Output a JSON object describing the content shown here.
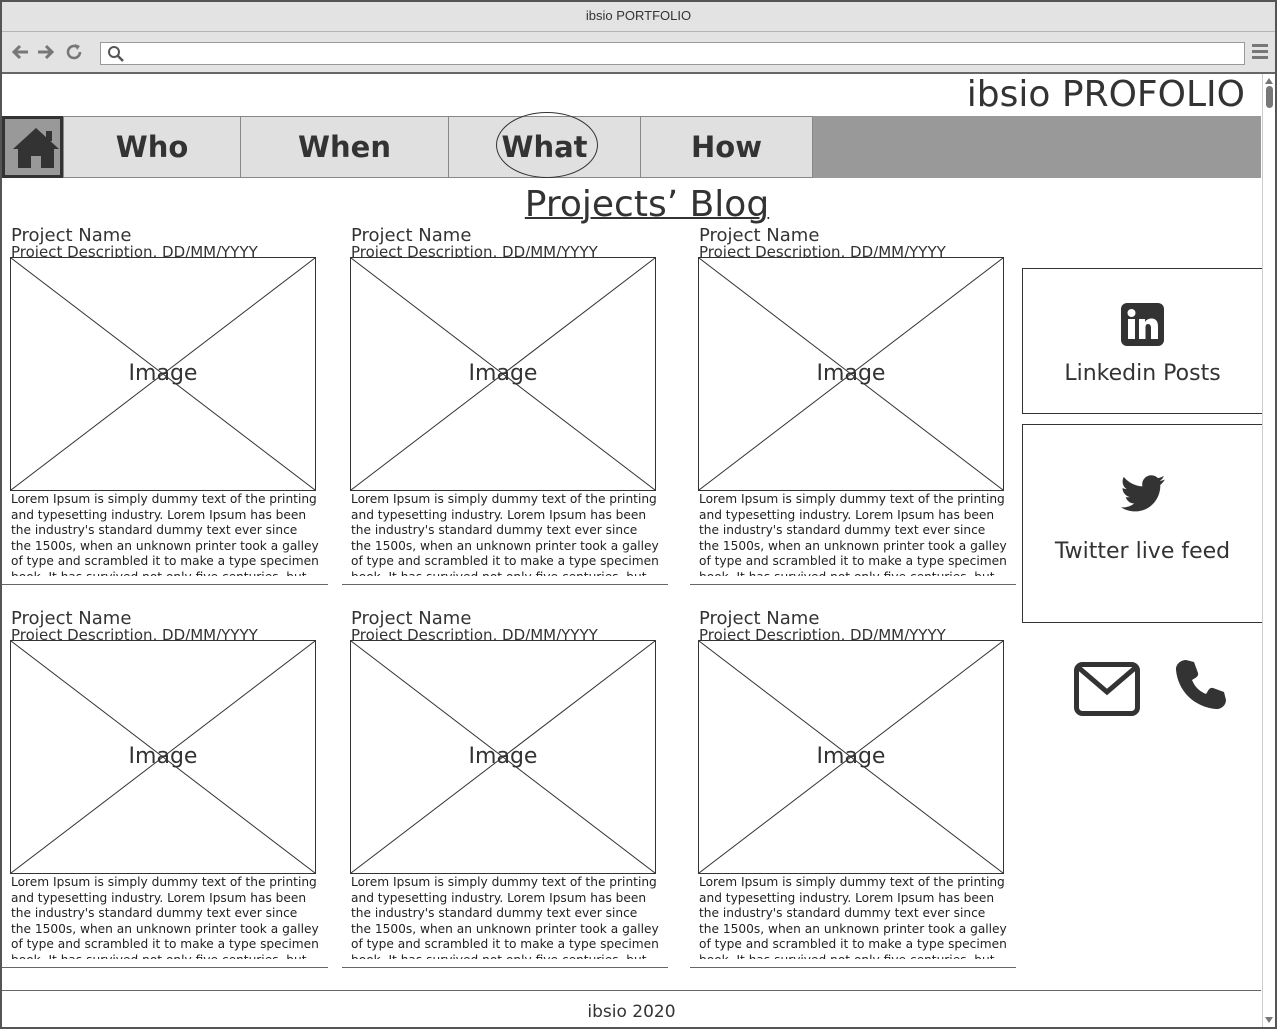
{
  "window": {
    "title": "ibsio PORTFOLIO"
  },
  "browser": {
    "url_value": "",
    "back_icon": "arrow-left-icon",
    "forward_icon": "arrow-right-icon",
    "reload_icon": "reload-icon",
    "menu_icon": "hamburger-menu-icon"
  },
  "brand": "ibsio PROFOLIO",
  "nav": {
    "home_icon": "home-icon",
    "tabs": [
      {
        "label": "Who"
      },
      {
        "label": "When"
      },
      {
        "label": "What"
      },
      {
        "label": "How"
      }
    ],
    "active_tab": "What"
  },
  "page_title": "Projects’ Blog",
  "projects": [
    {
      "name": "Project Name",
      "description": "Project Description, DD/MM/YYYY",
      "image_label": "Image",
      "body": "Lorem Ipsum is simply dummy text of the printing and typesetting industry. Lorem Ipsum has been the industry's standard dummy text ever since the 1500s, when an unknown printer took a galley of type and scrambled it to make a type specimen book. It has survived not only five centuries, but also"
    },
    {
      "name": "Project Name",
      "description": "Project Description, DD/MM/YYYY",
      "image_label": "Image",
      "body": "Lorem Ipsum is simply dummy text of the printing and typesetting industry. Lorem Ipsum has been the industry's standard dummy text ever since the 1500s, when an unknown printer took a galley of type and scrambled it to make a type specimen book. It has survived not only five centuries, but also"
    },
    {
      "name": "Project Name",
      "description": "Project Description, DD/MM/YYYY",
      "image_label": "Image",
      "body": "Lorem Ipsum is simply dummy text of the printing and typesetting industry. Lorem Ipsum has been the industry's standard dummy text ever since the 1500s, when an unknown printer took a galley of type and scrambled it to make a type specimen book. It has survived not only five centuries, but also"
    },
    {
      "name": "Project Name",
      "description": "Project Description, DD/MM/YYYY",
      "image_label": "Image",
      "body": "Lorem Ipsum is simply dummy text of the printing and typesetting industry. Lorem Ipsum has been the industry's standard dummy text ever since the 1500s, when an unknown printer took a galley of type and scrambled it to make a type specimen book. It has survived not only five centuries, but also"
    },
    {
      "name": "Project Name",
      "description": "Project Description, DD/MM/YYYY",
      "image_label": "Image",
      "body": "Lorem Ipsum is simply dummy text of the printing and typesetting industry. Lorem Ipsum has been the industry's standard dummy text ever since the 1500s, when an unknown printer took a galley of type and scrambled it to make a type specimen book. It has survived not only five centuries, but also"
    },
    {
      "name": "Project Name",
      "description": "Project Description, DD/MM/YYYY",
      "image_label": "Image",
      "body": "Lorem Ipsum is simply dummy text of the printing and typesetting industry. Lorem Ipsum has been the industry's standard dummy text ever since the 1500s, when an unknown printer took a galley of type and scrambled it to make a type specimen book. It has survived not only five centuries, but also"
    }
  ],
  "sidebar": {
    "linkedin": {
      "label": "Linkedin Posts",
      "icon": "linkedin-icon"
    },
    "twitter": {
      "label": "Twitter live feed",
      "icon": "twitter-icon"
    },
    "contact": {
      "mail_icon": "envelope-icon",
      "phone_icon": "phone-icon"
    }
  },
  "footer": "ibsio 2020",
  "colors": {
    "navbar": "#999999",
    "tab": "#e0e0e0",
    "text": "#333333",
    "chrome": "#e3e3e3"
  }
}
